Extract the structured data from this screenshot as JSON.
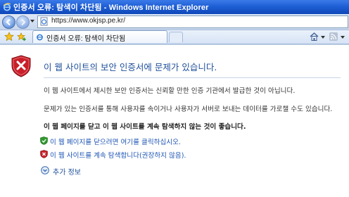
{
  "window": {
    "title": "인증서 오류: 탐색이 차단됨 - Windows Internet Explorer",
    "icon": "ie-logo-icon"
  },
  "address_bar": {
    "url": "https://www.okjsp.pe.kr/",
    "icon": "page-icon"
  },
  "tabs": [
    {
      "label": "인증서 오류: 탐색이 차단됨",
      "icon": "ie-page-icon",
      "active": true
    }
  ],
  "toolbar": {
    "favorites_icon": "star-icon",
    "add_favorites_icon": "add-favorites-icon",
    "home_icon": "home-icon",
    "feeds_icon": "rss-icon"
  },
  "content": {
    "heading": "이 웹 사이트의 보안 인증서에 문제가 있습니다.",
    "paragraph1": "이 웹 사이트에서 제시한 보안 인증서는 신뢰할 만한 인증 기관에서 발급한 것이 아닙니다.",
    "paragraph2": "문제가 있는 인증서를 통해 사용자를 속이거나 사용자가 서버로 보내는 데이터를 가로챌 수도 있습니다.",
    "recommendation": "이 웹 페이지를 닫고 이 웹 사이트를 계속 탐색하지 않는 것이 좋습니다.",
    "option_close": "이 웹 페이지를 닫으려면 여기를 클릭하십시오.",
    "option_continue": "이 웹 사이트를 계속 탐색합니다(권장하지 않음).",
    "more_info": "추가 정보"
  },
  "colors": {
    "title_bar": "#1f5fd6",
    "heading": "#1f4f9b",
    "link": "#1c54b4",
    "shield_red": "#c8202a",
    "ok_green": "#2e9a2e"
  }
}
